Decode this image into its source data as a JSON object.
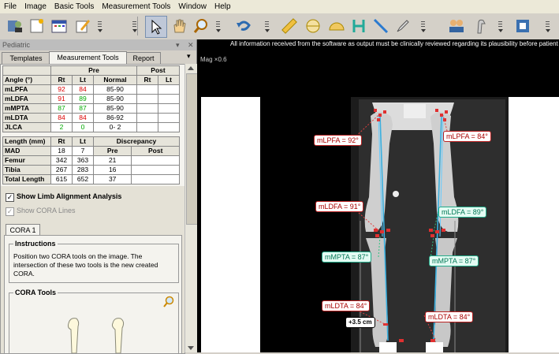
{
  "menubar": [
    "File",
    "Image",
    "Basic Tools",
    "Measurement Tools",
    "Window",
    "Help"
  ],
  "toolbar": {
    "icons": [
      "patient-icon",
      "new-image-icon",
      "calendar-icon",
      "edit-icon",
      "pointer-icon",
      "hand-icon",
      "zoom-icon",
      "undo-icon",
      "ruler-icon",
      "circle-tool-icon",
      "protractor-icon",
      "h-tool-icon",
      "line-tool-icon",
      "pen-tool-icon",
      "users-icon",
      "implant-icon",
      "export-icon"
    ]
  },
  "panel": {
    "title": "Pediatric",
    "tabs": [
      "Templates",
      "Measurement Tools",
      "Report"
    ],
    "angle_table": {
      "header_top": [
        "Pre",
        "Post"
      ],
      "header": [
        "Angle (°)",
        "Rt",
        "Lt",
        "Normal",
        "Rt",
        "Lt"
      ],
      "rows": [
        {
          "name": "mLPFA",
          "rt": "92",
          "lt": "84",
          "normal": "85-90",
          "rt_color": "red",
          "lt_color": "red"
        },
        {
          "name": "mLDFA",
          "rt": "91",
          "lt": "89",
          "normal": "85-90",
          "rt_color": "red",
          "lt_color": "green"
        },
        {
          "name": "mMPTA",
          "rt": "87",
          "lt": "87",
          "normal": "85-90",
          "rt_color": "green",
          "lt_color": "green"
        },
        {
          "name": "mLDTA",
          "rt": "84",
          "lt": "84",
          "normal": "86-92",
          "rt_color": "red",
          "lt_color": "red"
        },
        {
          "name": "JLCA",
          "rt": "2",
          "lt": "0",
          "normal": "0- 2",
          "rt_color": "green",
          "lt_color": "green"
        }
      ]
    },
    "length_table": {
      "header": [
        "Length (mm)",
        "Rt",
        "Lt",
        "Discrepancy"
      ],
      "subheader": [
        "Pre",
        "Post"
      ],
      "rows": [
        {
          "name": "MAD",
          "rt": "18",
          "lt": "7",
          "pre": "",
          "post": ""
        },
        {
          "name": "Femur",
          "rt": "342",
          "lt": "363",
          "pre": "21",
          "post": ""
        },
        {
          "name": "Tibia",
          "rt": "267",
          "lt": "283",
          "pre": "16",
          "post": ""
        },
        {
          "name": "Total Length",
          "rt": "615",
          "lt": "652",
          "pre": "37",
          "post": ""
        }
      ]
    },
    "show_limb": "Show Limb Alignment Analysis",
    "show_cora": "Show CORA Lines",
    "cora_tab": "CORA 1",
    "instructions_title": "Instructions",
    "instructions_text": "Position two CORA tools on the image. The intersection of these two tools is the new created CORA.",
    "cora_tools_title": "CORA Tools"
  },
  "viewer": {
    "notice": "All information received from the software as output must be clinically reviewed regarding its plausibility before patient treat",
    "mag": "Mag ×0.6",
    "labels": {
      "lpfa_r": "mLPFA = 92°",
      "lpfa_l": "mLPFA = 84°",
      "ldfa_r": "mLDFA = 91°",
      "ldfa_l": "mLDFA = 89°",
      "mpta_r": "mMPTA = 87°",
      "mpta_l": "mMPTA = 87°",
      "ldta_r": "mLDTA = 84°",
      "ldta_l": "mLDTA = 84°",
      "offset": "+3.5 cm"
    }
  },
  "colors": {
    "red": "#d00000",
    "green": "#00a000",
    "accent_line": "#3ab0e0"
  }
}
